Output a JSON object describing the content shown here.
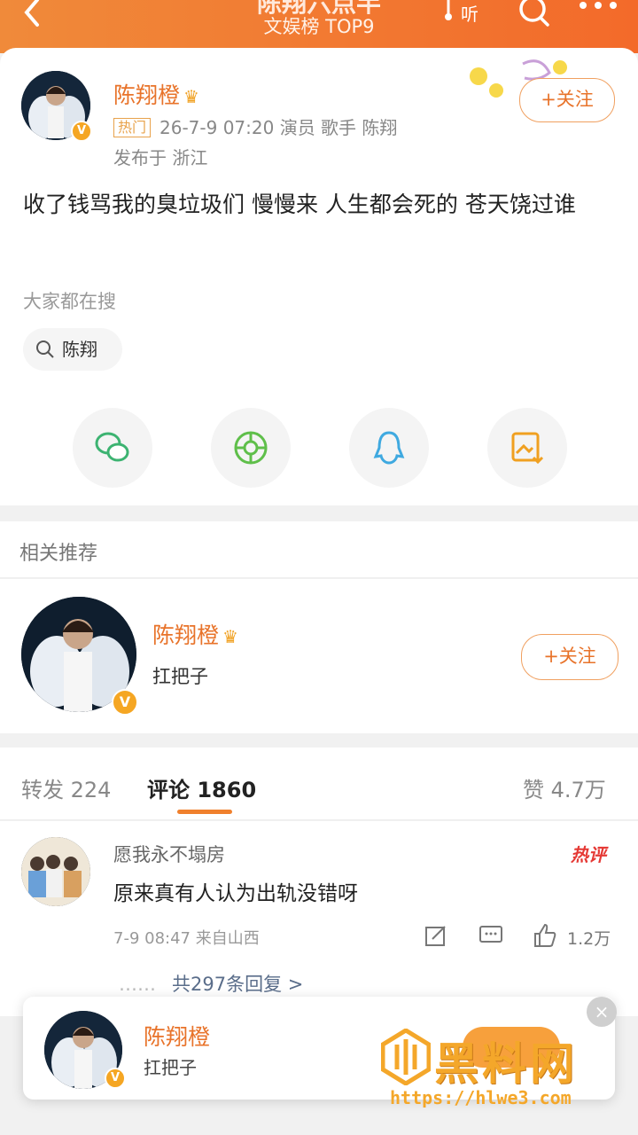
{
  "header": {
    "title": "陈翔六点半",
    "subtitle": "文娱榜 TOP9",
    "listen_label": "听"
  },
  "post": {
    "author": "陈翔橙",
    "hot_tag": "热门",
    "meta": "26-7-9 07:20  演员 歌手 陈翔",
    "location": "发布于 浙江",
    "follow_label": "+关注",
    "content": "收了钱骂我的臭垃圾们 慢慢来 人生都会死的 苍天饶过谁",
    "everyone_searching": "大家都在搜",
    "search_chip": "陈翔"
  },
  "related": {
    "heading": "相关推荐",
    "name": "陈翔橙",
    "desc": "扛把子",
    "follow_label": "+关注"
  },
  "tabs": {
    "repost": "转发 224",
    "comments": "评论 1860",
    "likes": "赞 4.7万"
  },
  "comment": {
    "user": "愿我永不塌房",
    "hot_label": "热评",
    "text": "原来真有人认为出轨没错呀",
    "meta": "7-9 08:47  来自山西",
    "like_count": "1.2万",
    "replies": "共297条回复 >",
    "replies_dots": "……"
  },
  "popup": {
    "name": "陈翔橙",
    "desc": "扛把子",
    "close": "×"
  },
  "watermark": {
    "text": "黑料网",
    "url": "https://hlwe3.com"
  },
  "colors": {
    "accent": "#f36a2a",
    "name": "#e8732a",
    "wechat": "#3cb371",
    "moments": "#5fbf4a",
    "qq": "#3fa9e0",
    "save": "#f0a020"
  }
}
